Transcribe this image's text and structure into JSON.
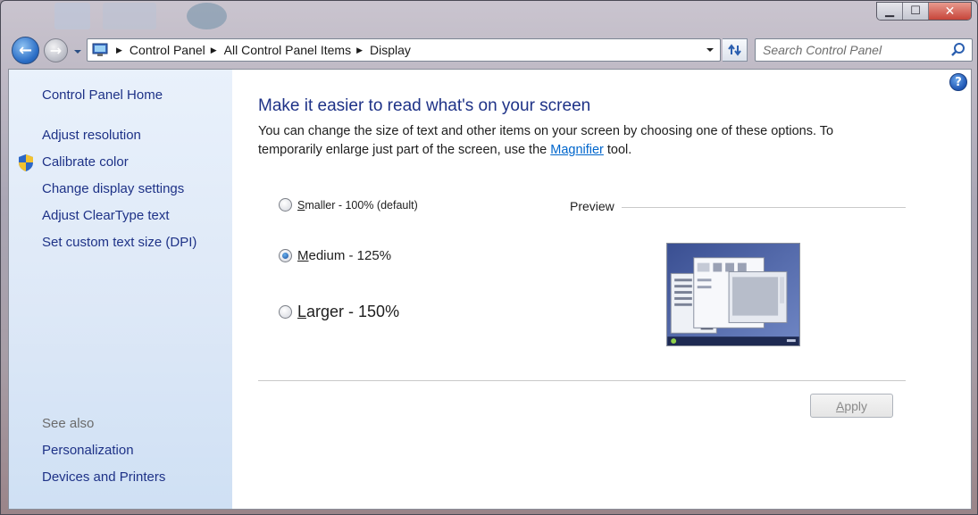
{
  "window": {
    "caption_buttons": {
      "minimize_icon": "minimize-icon",
      "maximize_icon": "maximize-icon",
      "close_icon": "close-icon"
    }
  },
  "navigation": {
    "back_icon": "back-arrow-icon",
    "forward_icon": "forward-arrow-icon",
    "breadcrumbs": [
      "Control Panel",
      "All Control Panel Items",
      "Display"
    ],
    "search_placeholder": "Search Control Panel"
  },
  "sidebar": {
    "home": "Control Panel Home",
    "tasks": [
      "Adjust resolution",
      "Calibrate color",
      "Change display settings",
      "Adjust ClearType text",
      "Set custom text size (DPI)"
    ],
    "see_also_heading": "See also",
    "see_also_links": [
      "Personalization",
      "Devices and Printers"
    ]
  },
  "main": {
    "heading": "Make it easier to read what's on your screen",
    "description_part1": "You can change the size of text and other items on your screen by choosing one of these options. To temporarily enlarge just part of the screen, use the ",
    "description_link": "Magnifier",
    "description_part2": " tool.",
    "options": [
      {
        "access_key": "S",
        "rest": "maller - 100% (default)",
        "checked": false
      },
      {
        "access_key": "M",
        "rest": "edium - 125%",
        "checked": true
      },
      {
        "access_key": "L",
        "rest": "arger - 150%",
        "checked": false
      }
    ],
    "preview_label": "Preview",
    "apply_access_key": "A",
    "apply_rest": "pply",
    "help_icon": "help-icon"
  },
  "colors": {
    "link_blue": "#1e3287",
    "hyperlink": "#0066cc",
    "sidebar_bg": "#dde8f7"
  }
}
